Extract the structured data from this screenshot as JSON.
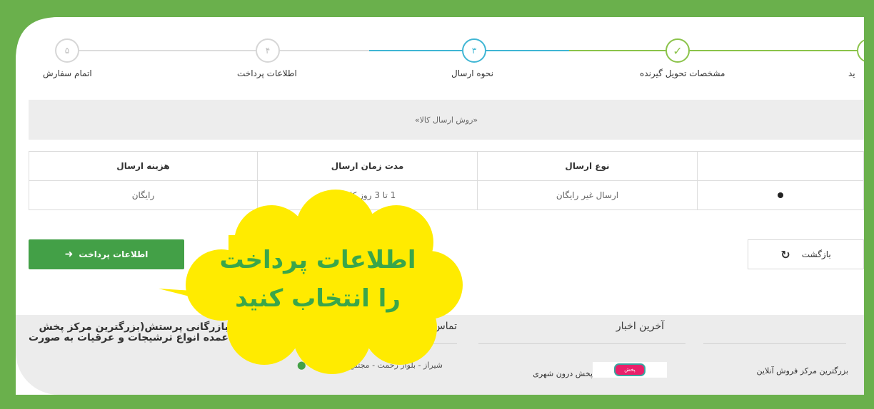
{
  "stepper": {
    "steps": [
      {
        "number": "",
        "label": "ید",
        "state": "done"
      },
      {
        "number": "✓",
        "label": "مشخصات تحویل گیرنده",
        "state": "done"
      },
      {
        "number": "۳",
        "label": "نحوه ارسال",
        "state": "active"
      },
      {
        "number": "۴",
        "label": "اطلاعات پرداخت",
        "state": "pending"
      },
      {
        "number": "۵",
        "label": "اتمام سفارش",
        "state": "pending"
      }
    ]
  },
  "shipping": {
    "method_title": "«روش ارسال کالا»",
    "headers": [
      "",
      "نوع ارسال",
      "مدت زمان ارسال",
      "هزینه ارسال"
    ],
    "row": {
      "type": "ارسال غیر رایگان",
      "duration": "1 تا 3 روز کاری",
      "cost": "رایگان"
    }
  },
  "buttons": {
    "payment": "اطلاعات پرداخت",
    "back": "بازگشت"
  },
  "callout": {
    "line1": "اطلاعات پرداخت",
    "line2": "را انتخاب کنید"
  },
  "footer": {
    "about": "بازرگانی پرستش(بزرگترین مرکز پخش عمده انواع ترشیجات و عرقیات به صورت",
    "contact_title": "تماس با ما",
    "news_title": "آخرین اخبار",
    "address": "شیراز - بلوار رحمت - مجتمع بازرگانان -",
    "news_item": "پخش درون شهری",
    "news_chip": "پخش",
    "online": "بزرگترین مرکز فروش آنلاین"
  },
  "colors": {
    "frame": "#6ab04c",
    "accent_green": "#43a047",
    "active_step": "#3fb6d4",
    "callout": "#ffeb00",
    "callout_text": "#3aa64a"
  }
}
